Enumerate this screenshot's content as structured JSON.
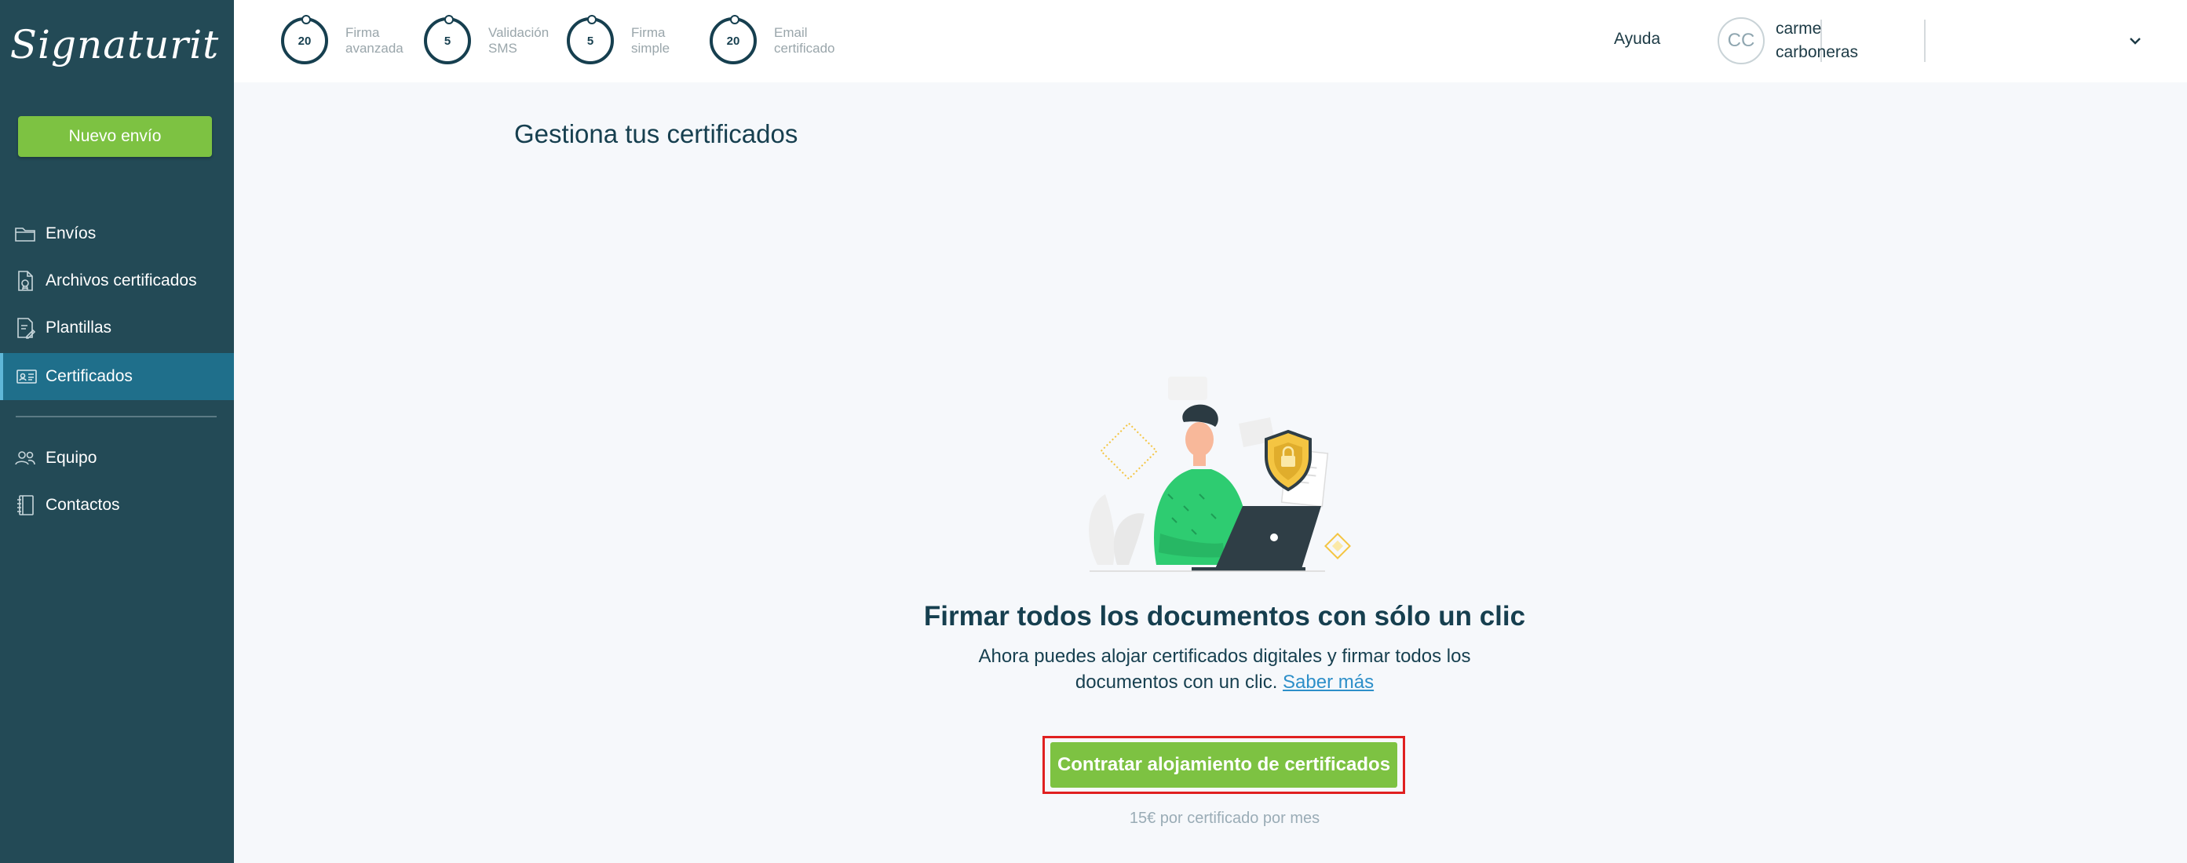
{
  "brand": {
    "logo_text": "Signaturit",
    "accent": "#7dc242",
    "sidebar_bg": "#234a56",
    "active_bg": "#1f6f8b"
  },
  "sidebar": {
    "new_button": "Nuevo envío",
    "items": [
      {
        "label": "Envíos",
        "icon": "folder-icon"
      },
      {
        "label": "Archivos certificados",
        "icon": "certified-file-icon"
      },
      {
        "label": "Plantillas",
        "icon": "template-icon"
      },
      {
        "label": "Certificados",
        "icon": "id-card-icon",
        "active": true
      },
      {
        "label": "Equipo",
        "icon": "team-icon"
      },
      {
        "label": "Contactos",
        "icon": "address-book-icon"
      }
    ]
  },
  "topbar": {
    "credits": [
      {
        "value": "20",
        "label": "Firma avanzada"
      },
      {
        "value": "5",
        "label": "Validación SMS"
      },
      {
        "value": "5",
        "label": "Firma simple"
      },
      {
        "value": "20",
        "label": "Email certificado"
      }
    ],
    "help": "Ayuda",
    "user": {
      "initials": "CC",
      "first": "carme",
      "last": "carboneras"
    }
  },
  "main": {
    "title": "Gestiona tus certificados",
    "headline": "Firmar todos los documentos con sólo un clic",
    "description": "Ahora puedes alojar certificados digitales y firmar todos los documentos con un clic.",
    "link": "Saber más",
    "cta": "Contratar alojamiento de certificados",
    "price": "15€ por certificado por mes"
  }
}
